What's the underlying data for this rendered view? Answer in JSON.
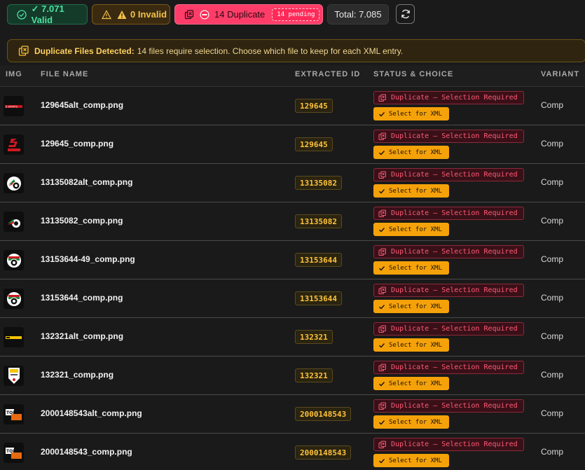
{
  "stats": {
    "valid_label": "✓ 7.071 Valid",
    "invalid_label": "0 Invalid",
    "duplicate_label": "14 Duplicate",
    "pending_label": "14 pending",
    "total_label": "Total: 7.085"
  },
  "banner": {
    "title": "Duplicate Files Detected:",
    "message": "14 files require selection. Choose which file to keep for each XML entry."
  },
  "columns": {
    "img": "IMG",
    "file_name": "FILE NAME",
    "extracted_id": "EXTRACTED ID",
    "status": "STATUS & CHOICE",
    "variant": "VARIANT"
  },
  "rows": [
    {
      "file": "129645alt_comp.png",
      "id": "129645",
      "status": "Duplicate – Selection Required",
      "action": "Select for XML",
      "variant": "Comp",
      "thumb": "red-s-logo-wide"
    },
    {
      "file": "129645_comp.png",
      "id": "129645",
      "status": "Duplicate – Selection Required",
      "action": "Select for XML",
      "variant": "Comp",
      "thumb": "red-s-logo"
    },
    {
      "file": "13135082alt_comp.png",
      "id": "13135082",
      "status": "Duplicate – Selection Required",
      "action": "Select for XML",
      "variant": "Comp",
      "thumb": "football-crest-green"
    },
    {
      "file": "13135082_comp.png",
      "id": "13135082",
      "status": "Duplicate – Selection Required",
      "action": "Select for XML",
      "variant": "Comp",
      "thumb": "football-crest-green-small"
    },
    {
      "file": "13153644-49_comp.png",
      "id": "13153644",
      "status": "Duplicate – Selection Required",
      "action": "Select for XML",
      "variant": "Comp",
      "thumb": "football-crest-egypt"
    },
    {
      "file": "13153644_comp.png",
      "id": "13153644",
      "status": "Duplicate – Selection Required",
      "action": "Select for XML",
      "variant": "Comp",
      "thumb": "football-crest-egypt"
    },
    {
      "file": "132321alt_comp.png",
      "id": "132321",
      "status": "Duplicate – Selection Required",
      "action": "Select for XML",
      "variant": "Comp",
      "thumb": "yellow-banner-logo"
    },
    {
      "file": "132321_comp.png",
      "id": "132321",
      "status": "Duplicate – Selection Required",
      "action": "Select for XML",
      "variant": "Comp",
      "thumb": "yellow-shield-logo"
    },
    {
      "file": "2000148543alt_comp.png",
      "id": "2000148543",
      "status": "Duplicate – Selection Required",
      "action": "Select for XML",
      "variant": "Comp",
      "thumb": "top-logo"
    },
    {
      "file": "2000148543_comp.png",
      "id": "2000148543",
      "status": "Duplicate – Selection Required",
      "action": "Select for XML",
      "variant": "Comp",
      "thumb": "top-logo"
    }
  ],
  "colors": {
    "valid": "#4ee0a0",
    "invalid": "#f3c24a",
    "duplicate": "#ff3d68",
    "id_text": "#ffc23a",
    "select_button": "#f5a20a"
  }
}
